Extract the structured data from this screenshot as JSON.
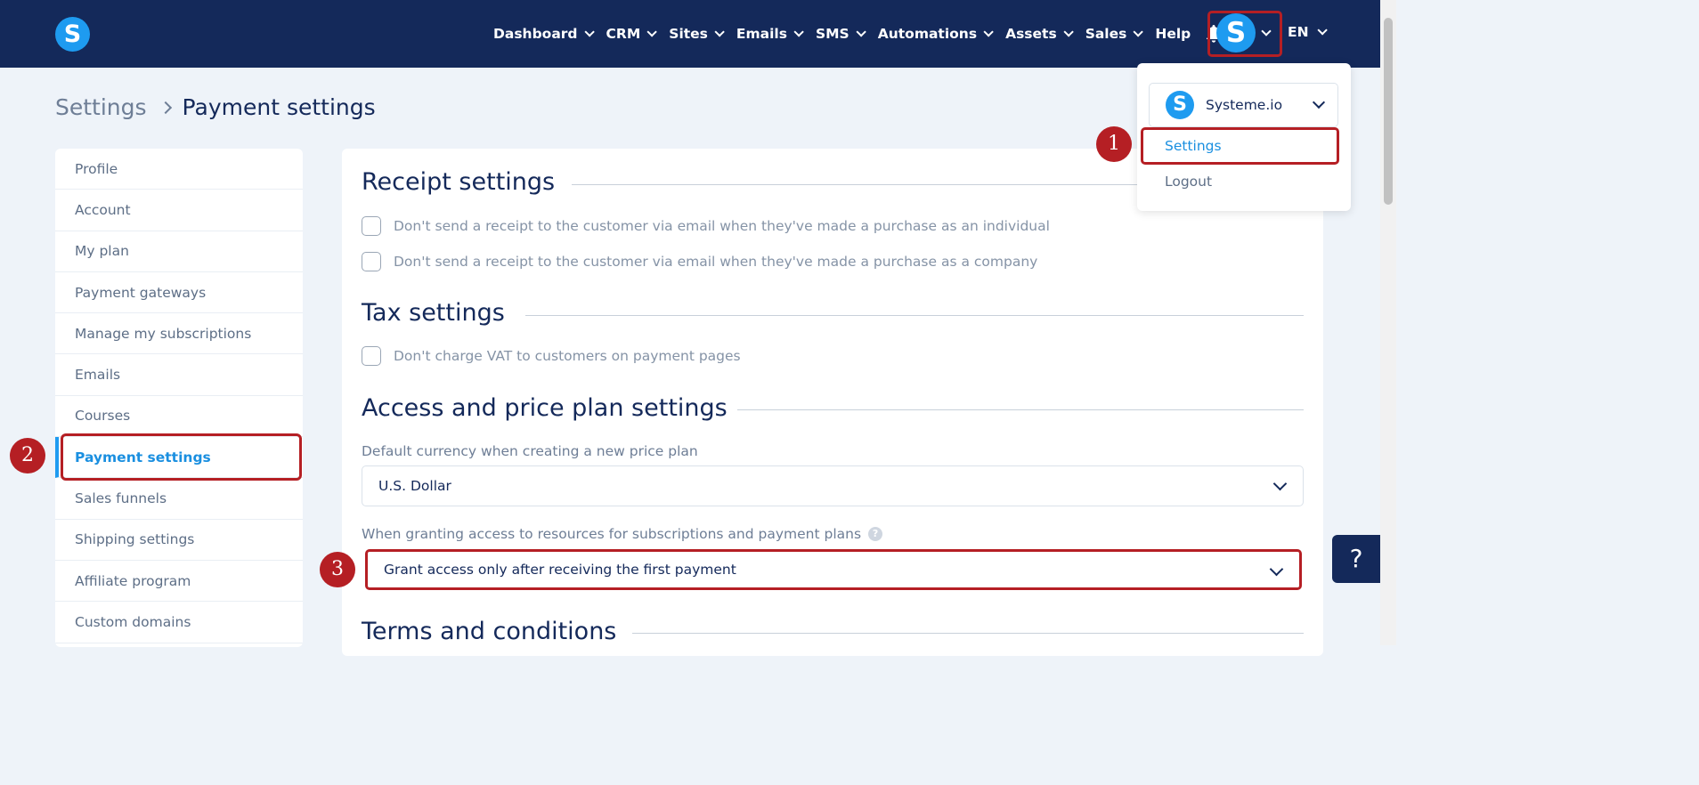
{
  "brand": {
    "logo_letter": "S",
    "accent_color": "#1e9bf0",
    "nav_bg": "#14295a",
    "annotation_color": "#b51f24"
  },
  "nav": {
    "items": [
      {
        "label": "Dashboard",
        "has_dropdown": true
      },
      {
        "label": "CRM",
        "has_dropdown": true
      },
      {
        "label": "Sites",
        "has_dropdown": true
      },
      {
        "label": "Emails",
        "has_dropdown": true
      },
      {
        "label": "SMS",
        "has_dropdown": true
      },
      {
        "label": "Automations",
        "has_dropdown": true
      },
      {
        "label": "Assets",
        "has_dropdown": true
      },
      {
        "label": "Sales",
        "has_dropdown": true
      },
      {
        "label": "Help",
        "has_dropdown": false
      }
    ],
    "bell_icon": "bell-icon",
    "avatar_letter": "S",
    "language": "EN"
  },
  "breadcrumb": {
    "parent": "Settings",
    "current": "Payment settings"
  },
  "sidebar": {
    "items": [
      {
        "label": "Profile"
      },
      {
        "label": "Account"
      },
      {
        "label": "My plan"
      },
      {
        "label": "Payment gateways"
      },
      {
        "label": "Manage my subscriptions"
      },
      {
        "label": "Emails"
      },
      {
        "label": "Courses"
      },
      {
        "label": "Payment settings",
        "active": true
      },
      {
        "label": "Sales funnels"
      },
      {
        "label": "Shipping settings"
      },
      {
        "label": "Affiliate program"
      },
      {
        "label": "Custom domains"
      }
    ]
  },
  "main": {
    "receipt": {
      "title": "Receipt settings",
      "options": [
        "Don't send a receipt to the customer via email when they've made a purchase as an individual",
        "Don't send a receipt to the customer via email when they've made a purchase as a company"
      ]
    },
    "tax": {
      "title": "Tax settings",
      "options": [
        "Don't charge VAT to customers on payment pages"
      ]
    },
    "access": {
      "title": "Access and price plan settings",
      "currency_label": "Default currency when creating a new price plan",
      "currency_value": "U.S. Dollar",
      "grant_label": "When granting access to resources for subscriptions and payment plans",
      "grant_help": "?",
      "grant_value": "Grant access only after receiving the first payment"
    },
    "terms": {
      "title": "Terms and conditions"
    }
  },
  "dropdown": {
    "account_name": "Systeme.io",
    "account_logo_letter": "S",
    "settings_label": "Settings",
    "logout_label": "Logout"
  },
  "annotations": {
    "badge_1": "1",
    "badge_2": "2",
    "badge_3": "3"
  },
  "help_button": "?"
}
